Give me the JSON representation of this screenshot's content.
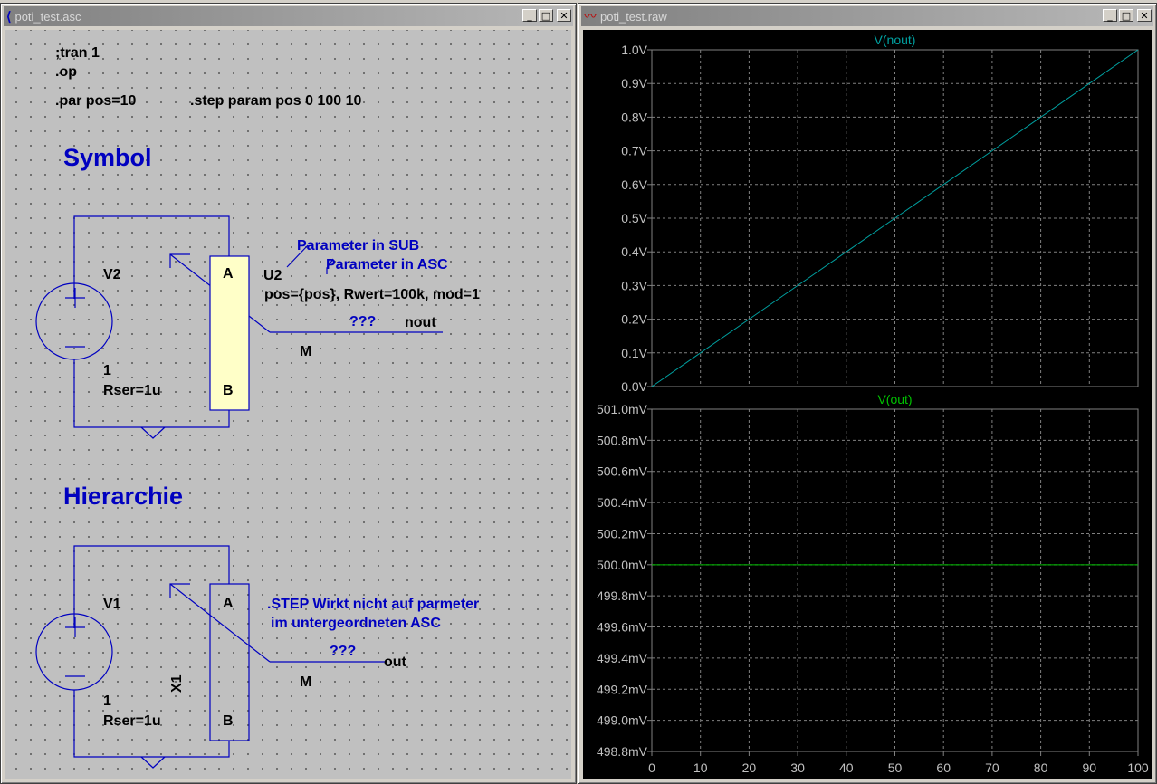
{
  "schematic_window": {
    "title": "poti_test.asc",
    "directives": {
      "tran": ";tran 1",
      "op": ".op",
      "par": ".par pos=10",
      "step": ".step param pos 0 100 10"
    },
    "section_symbol": "Symbol",
    "section_hierarchy": "Hierarchie",
    "symbol": {
      "source_name": "V2",
      "source_value": "1",
      "source_rser": "Rser=1u",
      "pin_a": "A",
      "pin_b": "B",
      "inst_name": "U2",
      "inst_params": "pos={pos}, Rwert=100k, mod=1",
      "note_sub": "Parameter in SUB",
      "note_asc": "Parameter in ASC",
      "qqq": "???",
      "net_label": "nout",
      "wiper_label": "M"
    },
    "hierarchy": {
      "source_name": "V1",
      "source_value": "1",
      "source_rser": "Rser=1u",
      "pin_a": "A",
      "pin_b": "B",
      "inst_name": "X1",
      "note_line1": ".STEP Wirkt nicht auf parmeter",
      "note_line2": "im untergeordneten ASC",
      "qqq": "???",
      "net_label": "out",
      "wiper_label": "M"
    }
  },
  "plot_window": {
    "title": "poti_test.raw",
    "colors": {
      "trace_top": "#00a0a0",
      "trace_bottom": "#00c000",
      "grid": "#808080"
    }
  },
  "chart_data": [
    {
      "type": "line",
      "title": "V(nout)",
      "x": [
        0,
        10,
        20,
        30,
        40,
        50,
        60,
        70,
        80,
        90,
        100
      ],
      "series": [
        {
          "name": "V(nout)",
          "values": [
            0.0,
            0.1,
            0.2,
            0.3,
            0.4,
            0.5,
            0.6,
            0.7,
            0.8,
            0.9,
            1.0
          ]
        }
      ],
      "xlim": [
        0,
        100
      ],
      "ylim": [
        0,
        1.0
      ],
      "yticks": [
        "1.0V",
        "0.9V",
        "0.8V",
        "0.7V",
        "0.6V",
        "0.5V",
        "0.4V",
        "0.3V",
        "0.2V",
        "0.1V",
        "0.0V"
      ],
      "grid": true
    },
    {
      "type": "line",
      "title": "V(out)",
      "x": [
        0,
        10,
        20,
        30,
        40,
        50,
        60,
        70,
        80,
        90,
        100
      ],
      "series": [
        {
          "name": "V(out)",
          "values": [
            500.0,
            500.0,
            500.0,
            500.0,
            500.0,
            500.0,
            500.0,
            500.0,
            500.0,
            500.0,
            500.0
          ]
        }
      ],
      "xlim": [
        0,
        100
      ],
      "ylim": [
        498.8,
        501.0
      ],
      "yticks": [
        "501.0mV",
        "500.8mV",
        "500.6mV",
        "500.4mV",
        "500.2mV",
        "500.0mV",
        "499.8mV",
        "499.6mV",
        "499.4mV",
        "499.2mV",
        "499.0mV",
        "498.8mV"
      ],
      "xticks": [
        "0",
        "10",
        "20",
        "30",
        "40",
        "50",
        "60",
        "70",
        "80",
        "90",
        "100"
      ],
      "grid": true
    }
  ]
}
